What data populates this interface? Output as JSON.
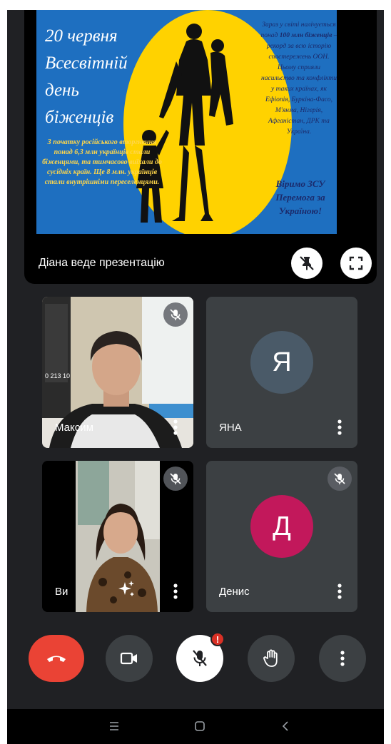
{
  "slide": {
    "title_lines": [
      "20 червня",
      "Всесвітній",
      "день",
      "біженців"
    ],
    "left_text": "З початку російського вторгнення понад 6,3 млн українців стали біженцями, та тимчасово виїхали до сусідніх країн. Ще 8 млн. українців стали внутрішніми переселенцями.",
    "right_text_a": "Зараз у світі налічується понад ",
    "right_text_bold1": "100 млн біженців",
    "right_text_b": " – рекорд за всю історію спостережень ООН. Цьому сприяли насильство та конфлікти у таких країнах, як Ефіопія, Буркіна-Фасо, М'янма, Нігерія, Афганістан, ДРК та Україна.",
    "slogan": "Віримо ЗСУ Перемога за Україною!",
    "colors": {
      "background": "#1e6fc0",
      "circle": "#ffd200",
      "silhouette": "#111111"
    }
  },
  "presenter_label": "Діана веде презентацію",
  "participants": [
    {
      "name": "Максим",
      "type": "video",
      "muted": true
    },
    {
      "name": "ЯНА",
      "type": "avatar",
      "initial": "Я",
      "color": "#4a5a68",
      "muted": false
    },
    {
      "name": "Ви",
      "type": "video",
      "muted": true
    },
    {
      "name": "Денис",
      "type": "avatar",
      "initial": "Д",
      "color": "#c2185b",
      "muted": true
    }
  ],
  "video_backdrop_text": {
    "maksym_poster": "0 213 10"
  },
  "controls": {
    "mic_badge": "!",
    "icons": [
      "phone-hangup-icon",
      "camera-icon",
      "mic-off-icon",
      "hand-raise-icon",
      "more-vert-icon"
    ]
  },
  "navbar": {
    "icons": [
      "menu-icon",
      "home-icon",
      "back-icon"
    ]
  }
}
